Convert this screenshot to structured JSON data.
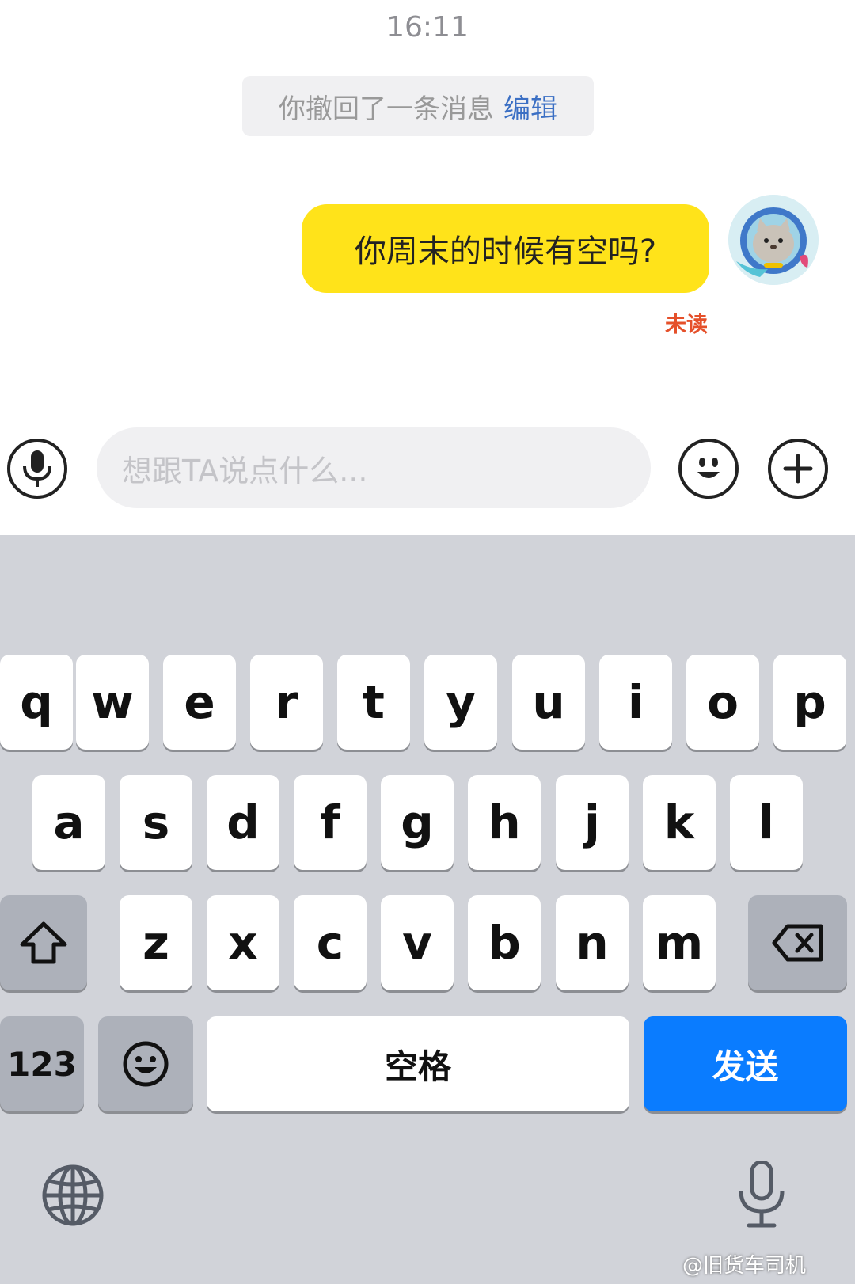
{
  "chat": {
    "time": "16:11",
    "recall_text": "你撤回了一条消息",
    "recall_edit": "编辑",
    "message": "你周末的时候有空吗?",
    "read_status": "未读"
  },
  "composer": {
    "placeholder": "想跟TA说点什么...",
    "voice_icon": "microphone-icon",
    "emoji_icon": "smile-icon",
    "plus_icon": "plus-icon"
  },
  "keyboard": {
    "row1": [
      "q",
      "w",
      "e",
      "r",
      "t",
      "y",
      "u",
      "i",
      "o",
      "p"
    ],
    "row2": [
      "a",
      "s",
      "d",
      "f",
      "g",
      "h",
      "j",
      "k",
      "l"
    ],
    "row3": [
      "z",
      "x",
      "c",
      "v",
      "b",
      "n",
      "m"
    ],
    "numbers_label": "123",
    "space_label": "空格",
    "send_label": "发送",
    "shift_icon": "shift-icon",
    "delete_icon": "backspace-icon",
    "emoji_icon": "emoji-icon",
    "globe_icon": "globe-icon",
    "dictation_icon": "microphone-icon"
  },
  "watermark": "@旧货车司机",
  "colors": {
    "bubble": "#ffe31a",
    "send_key": "#0a7cff",
    "unread": "#e5502a",
    "edit_link": "#3b6fc4"
  }
}
